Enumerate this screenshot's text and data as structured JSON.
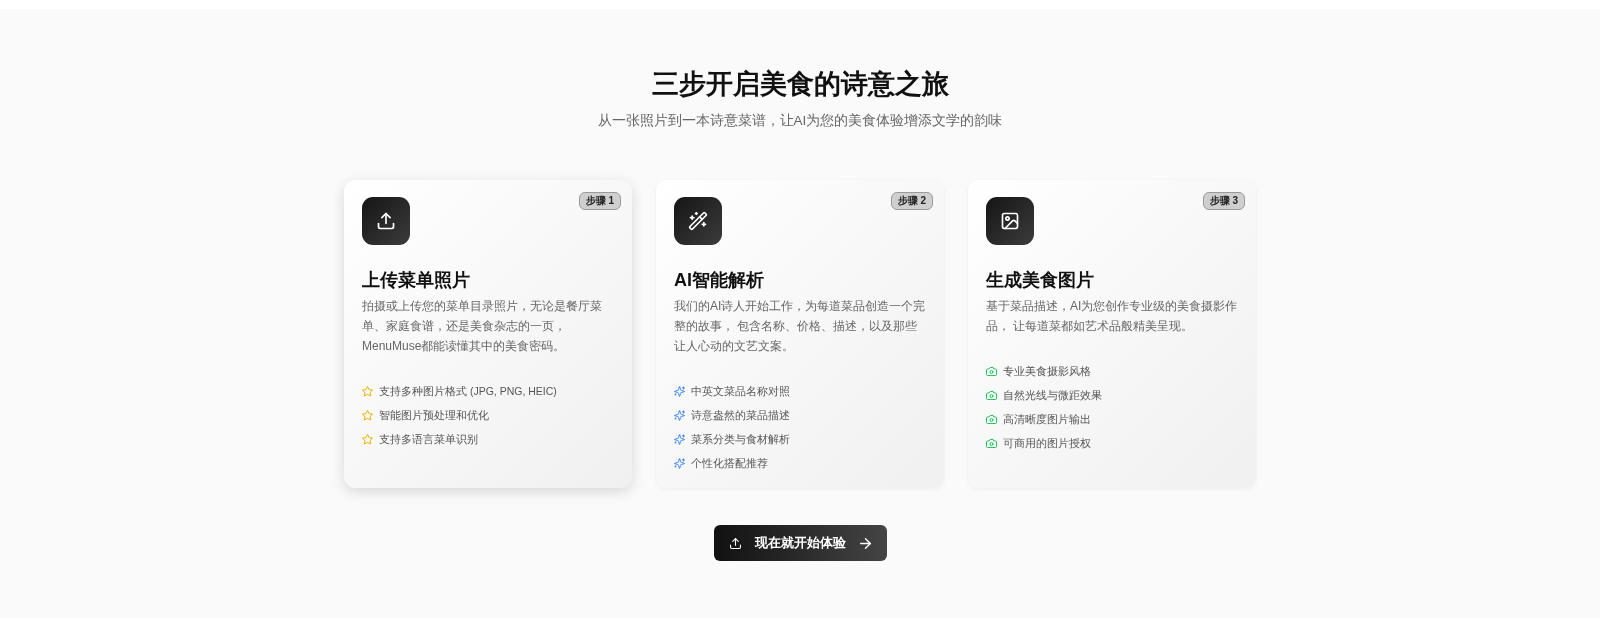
{
  "heading": {
    "title": "三步开启美食的诗意之旅",
    "subtitle": "从一张照片到一本诗意菜谱，让AI为您的美食体验增添文学的韵味"
  },
  "steps": [
    {
      "kind": "upload",
      "badge": "步骤 1",
      "title": "上传菜单照片",
      "description": "拍摄或上传您的菜单目录照片，无论是餐厅菜单、家庭食谱，还是美食杂志的一页，MenuMuse都能读懂其中的美食密码。",
      "hovered": true,
      "features": [
        "支持多种图片格式 (JPG, PNG, HEIC)",
        "智能图片预处理和优化",
        "支持多语言菜单识别"
      ]
    },
    {
      "kind": "magic",
      "badge": "步骤 2",
      "title": "AI智能解析",
      "description": "我们的AI诗人开始工作，为每道菜品创造一个完整的故事， 包含名称、价格、描述，以及那些让人心动的文艺文案。",
      "hovered": false,
      "features": [
        "中英文菜品名称对照",
        "诗意盎然的菜品描述",
        "菜系分类与食材解析",
        "个性化搭配推荐"
      ]
    },
    {
      "kind": "image",
      "badge": "步骤 3",
      "title": "生成美食图片",
      "description": "基于菜品描述，AI为您创作专业级的美食摄影作品， 让每道菜都如艺术品般精美呈现。",
      "hovered": false,
      "features": [
        "专业美食摄影风格",
        "自然光线与微距效果",
        "高清晰度图片输出",
        "可商用的图片授权"
      ]
    }
  ],
  "cta": {
    "label": "现在就开始体验"
  }
}
